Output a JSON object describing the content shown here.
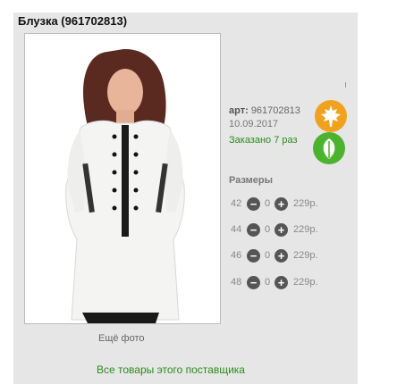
{
  "product": {
    "title": "Блузка (961702813)",
    "art_label": "арт:",
    "art_value": "961702813",
    "date": "10.09.2017",
    "ordered": "Заказано 7 раз"
  },
  "sizes": {
    "label": "Размеры",
    "rows": [
      {
        "size": "42",
        "qty": "0",
        "price": "229р."
      },
      {
        "size": "44",
        "qty": "0",
        "price": "229р."
      },
      {
        "size": "46",
        "qty": "0",
        "price": "229р."
      },
      {
        "size": "48",
        "qty": "0",
        "price": "229р."
      }
    ],
    "minus_symbol": "−",
    "plus_symbol": "+"
  },
  "links": {
    "more_photo": "Ещё фото",
    "supplier": "Все товары этого поставщика"
  },
  "icons": {
    "maple_leaf": "maple-leaf-icon",
    "leaf": "leaf-icon"
  },
  "colors": {
    "accent_green": "#2a8a1f",
    "orange": "#f0a21e",
    "green": "#4bb32e",
    "panel": "#e6e6e6"
  }
}
